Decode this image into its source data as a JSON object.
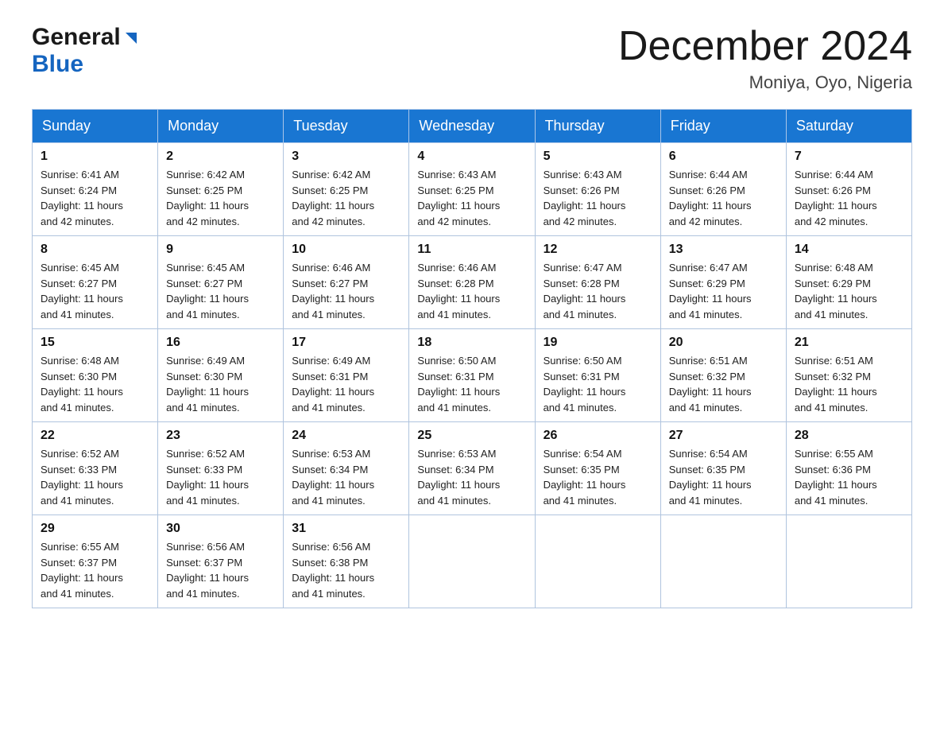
{
  "header": {
    "logo_general": "General",
    "logo_blue": "Blue",
    "title": "December 2024",
    "location": "Moniya, Oyo, Nigeria"
  },
  "days_of_week": [
    "Sunday",
    "Monday",
    "Tuesday",
    "Wednesday",
    "Thursday",
    "Friday",
    "Saturday"
  ],
  "weeks": [
    [
      {
        "day": "1",
        "sunrise": "6:41 AM",
        "sunset": "6:24 PM",
        "daylight": "11 hours and 42 minutes."
      },
      {
        "day": "2",
        "sunrise": "6:42 AM",
        "sunset": "6:25 PM",
        "daylight": "11 hours and 42 minutes."
      },
      {
        "day": "3",
        "sunrise": "6:42 AM",
        "sunset": "6:25 PM",
        "daylight": "11 hours and 42 minutes."
      },
      {
        "day": "4",
        "sunrise": "6:43 AM",
        "sunset": "6:25 PM",
        "daylight": "11 hours and 42 minutes."
      },
      {
        "day": "5",
        "sunrise": "6:43 AM",
        "sunset": "6:26 PM",
        "daylight": "11 hours and 42 minutes."
      },
      {
        "day": "6",
        "sunrise": "6:44 AM",
        "sunset": "6:26 PM",
        "daylight": "11 hours and 42 minutes."
      },
      {
        "day": "7",
        "sunrise": "6:44 AM",
        "sunset": "6:26 PM",
        "daylight": "11 hours and 42 minutes."
      }
    ],
    [
      {
        "day": "8",
        "sunrise": "6:45 AM",
        "sunset": "6:27 PM",
        "daylight": "11 hours and 41 minutes."
      },
      {
        "day": "9",
        "sunrise": "6:45 AM",
        "sunset": "6:27 PM",
        "daylight": "11 hours and 41 minutes."
      },
      {
        "day": "10",
        "sunrise": "6:46 AM",
        "sunset": "6:27 PM",
        "daylight": "11 hours and 41 minutes."
      },
      {
        "day": "11",
        "sunrise": "6:46 AM",
        "sunset": "6:28 PM",
        "daylight": "11 hours and 41 minutes."
      },
      {
        "day": "12",
        "sunrise": "6:47 AM",
        "sunset": "6:28 PM",
        "daylight": "11 hours and 41 minutes."
      },
      {
        "day": "13",
        "sunrise": "6:47 AM",
        "sunset": "6:29 PM",
        "daylight": "11 hours and 41 minutes."
      },
      {
        "day": "14",
        "sunrise": "6:48 AM",
        "sunset": "6:29 PM",
        "daylight": "11 hours and 41 minutes."
      }
    ],
    [
      {
        "day": "15",
        "sunrise": "6:48 AM",
        "sunset": "6:30 PM",
        "daylight": "11 hours and 41 minutes."
      },
      {
        "day": "16",
        "sunrise": "6:49 AM",
        "sunset": "6:30 PM",
        "daylight": "11 hours and 41 minutes."
      },
      {
        "day": "17",
        "sunrise": "6:49 AM",
        "sunset": "6:31 PM",
        "daylight": "11 hours and 41 minutes."
      },
      {
        "day": "18",
        "sunrise": "6:50 AM",
        "sunset": "6:31 PM",
        "daylight": "11 hours and 41 minutes."
      },
      {
        "day": "19",
        "sunrise": "6:50 AM",
        "sunset": "6:31 PM",
        "daylight": "11 hours and 41 minutes."
      },
      {
        "day": "20",
        "sunrise": "6:51 AM",
        "sunset": "6:32 PM",
        "daylight": "11 hours and 41 minutes."
      },
      {
        "day": "21",
        "sunrise": "6:51 AM",
        "sunset": "6:32 PM",
        "daylight": "11 hours and 41 minutes."
      }
    ],
    [
      {
        "day": "22",
        "sunrise": "6:52 AM",
        "sunset": "6:33 PM",
        "daylight": "11 hours and 41 minutes."
      },
      {
        "day": "23",
        "sunrise": "6:52 AM",
        "sunset": "6:33 PM",
        "daylight": "11 hours and 41 minutes."
      },
      {
        "day": "24",
        "sunrise": "6:53 AM",
        "sunset": "6:34 PM",
        "daylight": "11 hours and 41 minutes."
      },
      {
        "day": "25",
        "sunrise": "6:53 AM",
        "sunset": "6:34 PM",
        "daylight": "11 hours and 41 minutes."
      },
      {
        "day": "26",
        "sunrise": "6:54 AM",
        "sunset": "6:35 PM",
        "daylight": "11 hours and 41 minutes."
      },
      {
        "day": "27",
        "sunrise": "6:54 AM",
        "sunset": "6:35 PM",
        "daylight": "11 hours and 41 minutes."
      },
      {
        "day": "28",
        "sunrise": "6:55 AM",
        "sunset": "6:36 PM",
        "daylight": "11 hours and 41 minutes."
      }
    ],
    [
      {
        "day": "29",
        "sunrise": "6:55 AM",
        "sunset": "6:37 PM",
        "daylight": "11 hours and 41 minutes."
      },
      {
        "day": "30",
        "sunrise": "6:56 AM",
        "sunset": "6:37 PM",
        "daylight": "11 hours and 41 minutes."
      },
      {
        "day": "31",
        "sunrise": "6:56 AM",
        "sunset": "6:38 PM",
        "daylight": "11 hours and 41 minutes."
      },
      null,
      null,
      null,
      null
    ]
  ],
  "labels": {
    "sunrise": "Sunrise:",
    "sunset": "Sunset:",
    "daylight": "Daylight:"
  },
  "colors": {
    "header_bg": "#1976d2",
    "header_text": "#ffffff",
    "border": "#b0c4de"
  }
}
